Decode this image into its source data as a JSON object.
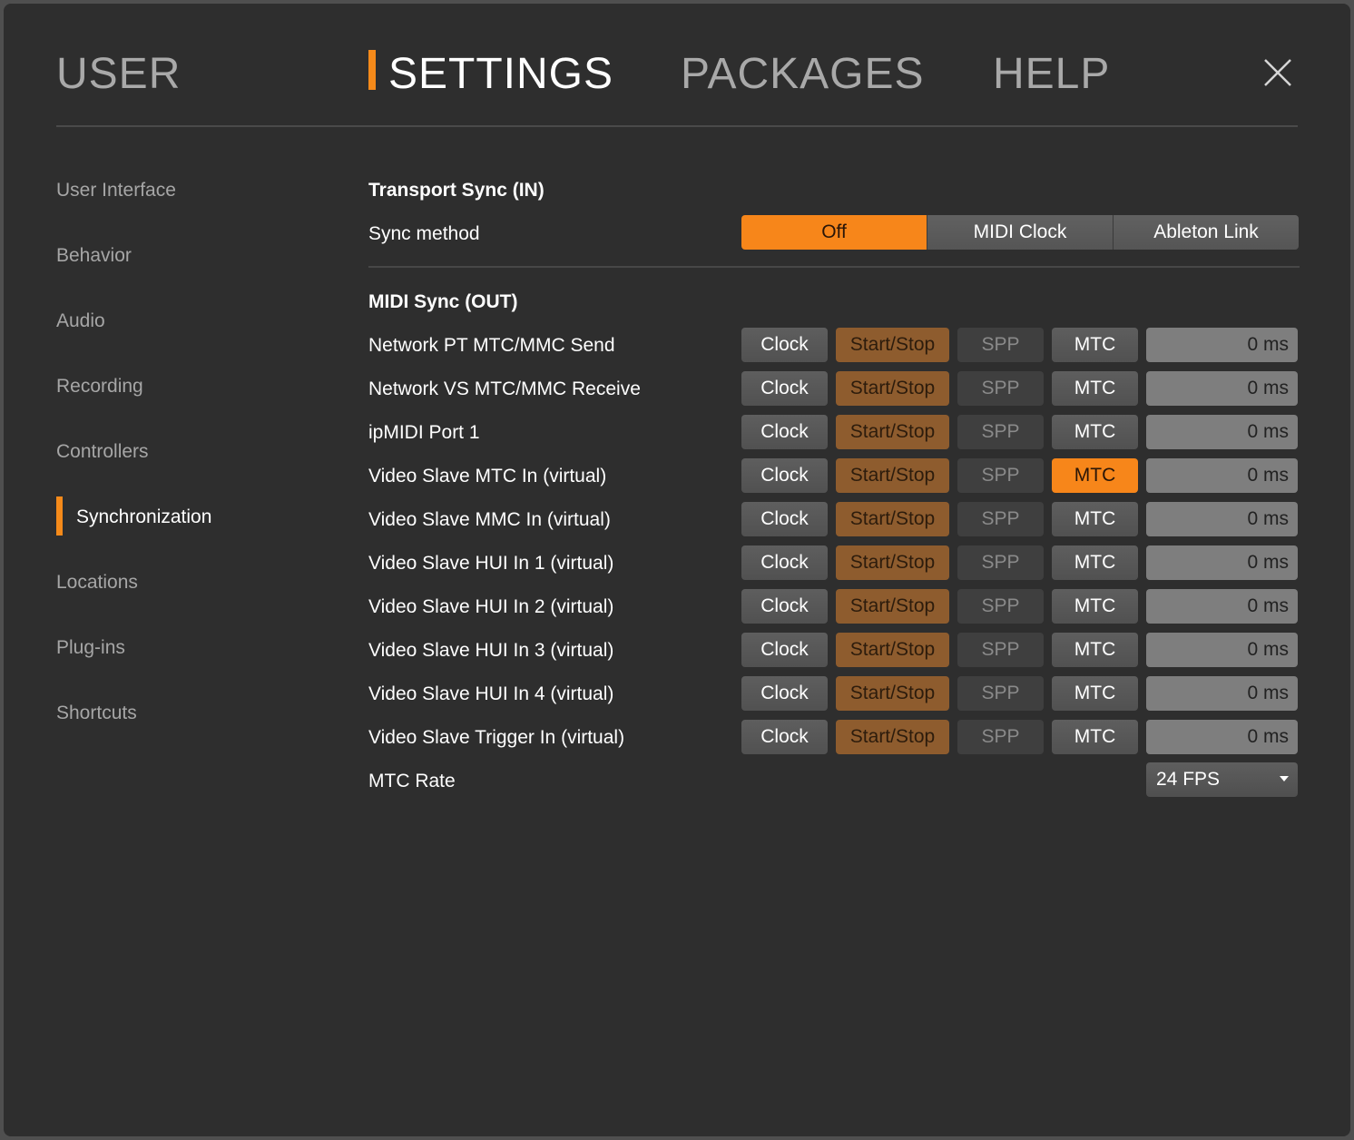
{
  "top_nav": {
    "tabs": [
      {
        "label": "USER",
        "active": false
      },
      {
        "label": "SETTINGS",
        "active": true
      },
      {
        "label": "PACKAGES",
        "active": false
      },
      {
        "label": "HELP",
        "active": false
      }
    ],
    "close_icon": "close-icon"
  },
  "sidebar": {
    "items": [
      {
        "label": "User Interface",
        "active": false
      },
      {
        "label": "Behavior",
        "active": false
      },
      {
        "label": "Audio",
        "active": false
      },
      {
        "label": "Recording",
        "active": false
      },
      {
        "label": "Controllers",
        "active": false
      },
      {
        "label": "Synchronization",
        "active": true
      },
      {
        "label": "Locations",
        "active": false
      },
      {
        "label": "Plug-ins",
        "active": false
      },
      {
        "label": "Shortcuts",
        "active": false
      }
    ]
  },
  "transport_sync": {
    "title": "Transport Sync (IN)",
    "sync_method_label": "Sync method",
    "options": [
      "Off",
      "MIDI Clock",
      "Ableton Link"
    ],
    "selected": "Off"
  },
  "midi_sync": {
    "title": "MIDI Sync (OUT)",
    "button_labels": {
      "clock": "Clock",
      "start_stop": "Start/Stop",
      "spp": "SPP",
      "mtc": "MTC"
    },
    "rows": [
      {
        "name": "Network PT MTC/MMC Send",
        "clock": false,
        "start_stop": true,
        "spp": false,
        "mtc": false,
        "offset": "0 ms"
      },
      {
        "name": "Network VS MTC/MMC Receive",
        "clock": false,
        "start_stop": true,
        "spp": false,
        "mtc": false,
        "offset": "0 ms"
      },
      {
        "name": "ipMIDI Port 1",
        "clock": false,
        "start_stop": true,
        "spp": false,
        "mtc": false,
        "offset": "0 ms"
      },
      {
        "name": "Video Slave MTC In (virtual)",
        "clock": false,
        "start_stop": true,
        "spp": false,
        "mtc": true,
        "offset": "0 ms"
      },
      {
        "name": "Video Slave MMC In (virtual)",
        "clock": false,
        "start_stop": true,
        "spp": false,
        "mtc": false,
        "offset": "0 ms"
      },
      {
        "name": "Video Slave HUI In 1 (virtual)",
        "clock": false,
        "start_stop": true,
        "spp": false,
        "mtc": false,
        "offset": "0 ms"
      },
      {
        "name": "Video Slave HUI In 2 (virtual)",
        "clock": false,
        "start_stop": true,
        "spp": false,
        "mtc": false,
        "offset": "0 ms"
      },
      {
        "name": "Video Slave HUI In 3 (virtual)",
        "clock": false,
        "start_stop": true,
        "spp": false,
        "mtc": false,
        "offset": "0 ms"
      },
      {
        "name": "Video Slave HUI In 4 (virtual)",
        "clock": false,
        "start_stop": true,
        "spp": false,
        "mtc": false,
        "offset": "0 ms"
      },
      {
        "name": "Video Slave Trigger In (virtual)",
        "clock": false,
        "start_stop": true,
        "spp": false,
        "mtc": false,
        "offset": "0 ms"
      }
    ],
    "mtc_rate_label": "MTC Rate",
    "mtc_rate_value": "24 FPS"
  },
  "colors": {
    "accent": "#f58a1a",
    "background": "#2e2e2e",
    "start_stop_active": "#8e5c2e"
  }
}
